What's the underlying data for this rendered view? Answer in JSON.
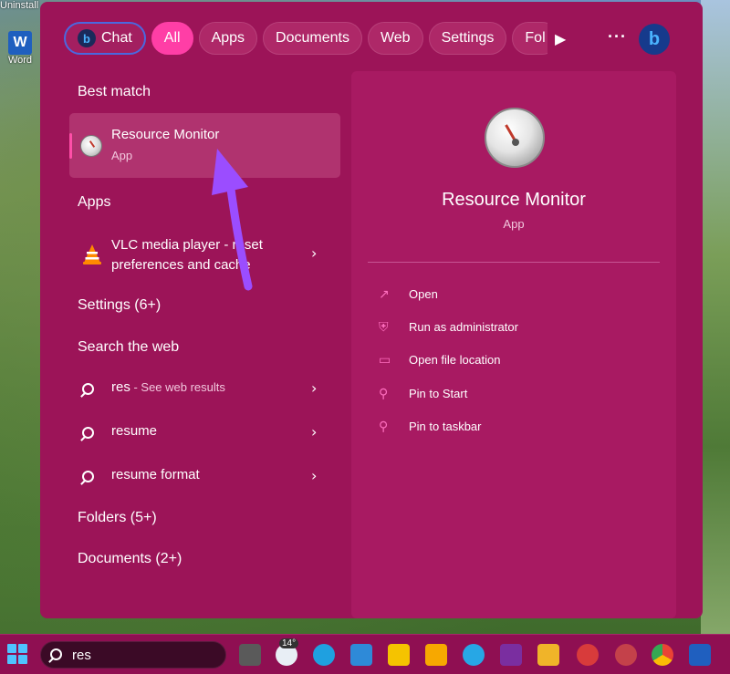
{
  "desktop": {
    "top_label": "Uninstall",
    "word_icon_letter": "W",
    "word_label": "Word"
  },
  "filters": [
    {
      "label": "Chat",
      "icon": "bing-icon",
      "state": "chat"
    },
    {
      "label": "All",
      "state": "active"
    },
    {
      "label": "Apps"
    },
    {
      "label": "Documents"
    },
    {
      "label": "Web"
    },
    {
      "label": "Settings"
    },
    {
      "label": "Fol"
    }
  ],
  "filter_controls": {
    "more_arrow": "▶",
    "more_dots": "···",
    "bing_letter": "b"
  },
  "results": {
    "best_match_heading": "Best match",
    "best_match": {
      "title": "Resource Monitor",
      "subtitle": "App",
      "icon": "resource-monitor-icon"
    },
    "apps_heading": "Apps",
    "vlc": {
      "line1": "VLC media player - reset",
      "line2": "preferences and cache",
      "icon": "vlc-icon"
    },
    "settings_heading": "Settings (6+)",
    "web_heading": "Search the web",
    "web_items": [
      {
        "term": "res",
        "suffix": " - See web results"
      },
      {
        "term": "resume",
        "suffix": ""
      },
      {
        "term": "resume format",
        "suffix": ""
      }
    ],
    "folders_heading": "Folders (5+)",
    "documents_heading": "Documents (2+)",
    "chevron": "›"
  },
  "preview": {
    "title": "Resource Monitor",
    "subtitle": "App",
    "actions": [
      {
        "label": "Open",
        "icon": "open-external-icon",
        "glyph": "↗"
      },
      {
        "label": "Run as administrator",
        "icon": "shield-admin-icon",
        "glyph": "⛨"
      },
      {
        "label": "Open file location",
        "icon": "folder-icon",
        "glyph": "▭"
      },
      {
        "label": "Pin to Start",
        "icon": "pin-icon",
        "glyph": "⚲"
      },
      {
        "label": "Pin to taskbar",
        "icon": "pin-icon",
        "glyph": "⚲"
      }
    ]
  },
  "taskbar": {
    "search_value": "res",
    "weather_badge": "14°"
  },
  "colors": {
    "accent_pink": "#ff3ea6",
    "panel_bg": "#9c1458",
    "annotation_arrow": "#9b4dff"
  }
}
